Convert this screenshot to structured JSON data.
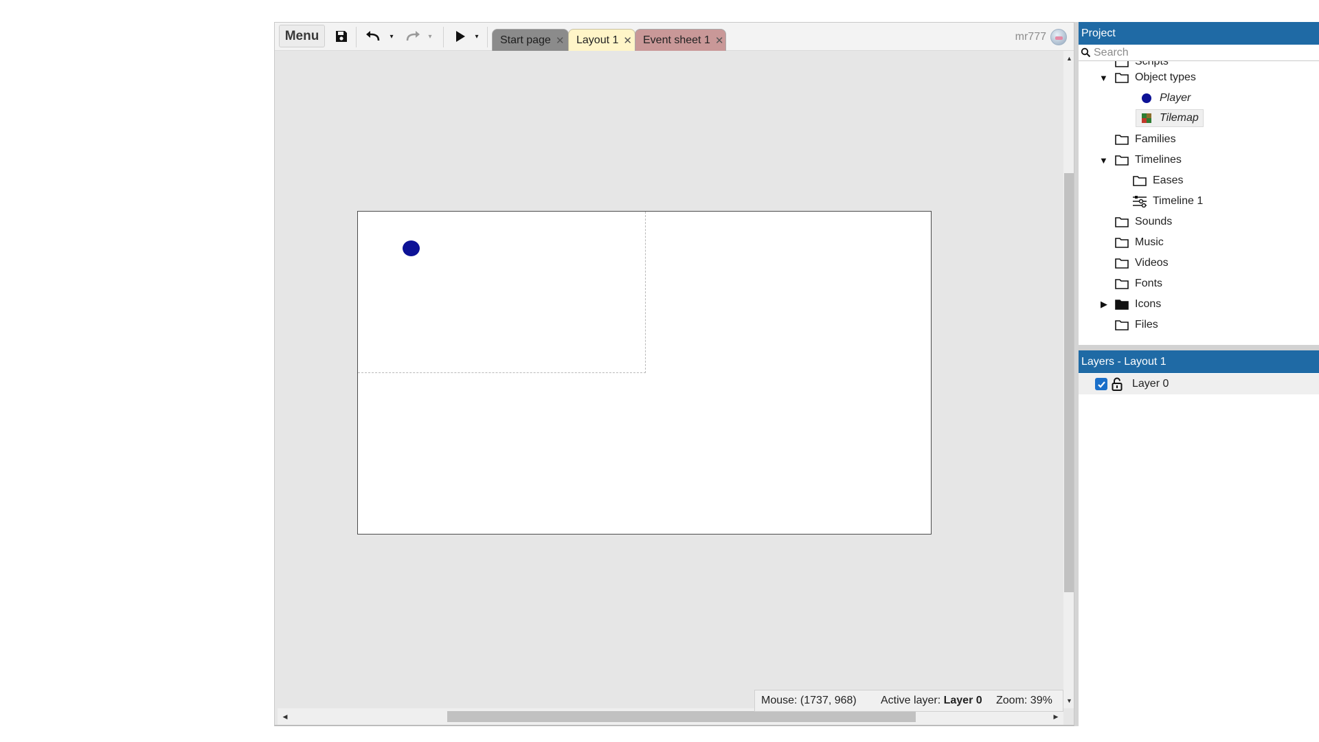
{
  "toolbar": {
    "menu_label": "Menu",
    "save_icon": "save-icon",
    "undo_icon": "undo-icon",
    "redo_icon": "redo-icon",
    "play_icon": "play-icon",
    "dropdown_glyph": "▾"
  },
  "tabs": [
    {
      "label": "Start page",
      "close": "✕",
      "color": "#8b8b8b"
    },
    {
      "label": "Layout 1",
      "close": "✕",
      "color": "#fff5c8",
      "active": true
    },
    {
      "label": "Event sheet 1",
      "close": "✕",
      "color": "#c99898"
    }
  ],
  "user": {
    "name": "mr777"
  },
  "canvas": {
    "background": "#e6e6e6",
    "layout_color": "#ffffff",
    "player_color": "#0d1296"
  },
  "status": {
    "mouse": "Mouse: (1737, 968)",
    "active_layer_label": "Active layer:",
    "active_layer_value": "Layer 0",
    "zoom": "Zoom: 39%"
  },
  "project": {
    "title": "Project",
    "search_placeholder": "Search",
    "items": [
      {
        "label": "Scripts",
        "icon": "folder-icon"
      },
      {
        "label": "Object types",
        "icon": "folder-icon",
        "expanded": true
      },
      {
        "label": "Player",
        "icon": "sprite-dot-icon",
        "italic": true
      },
      {
        "label": "Tilemap",
        "icon": "tilemap-icon",
        "italic": true,
        "selected": true
      },
      {
        "label": "Families",
        "icon": "folder-icon"
      },
      {
        "label": "Timelines",
        "icon": "folder-icon",
        "expanded": true
      },
      {
        "label": "Eases",
        "icon": "folder-icon"
      },
      {
        "label": "Timeline 1",
        "icon": "timeline-icon"
      },
      {
        "label": "Sounds",
        "icon": "folder-icon"
      },
      {
        "label": "Music",
        "icon": "folder-icon"
      },
      {
        "label": "Videos",
        "icon": "folder-icon"
      },
      {
        "label": "Fonts",
        "icon": "folder-icon"
      },
      {
        "label": "Icons",
        "icon": "folder-filled-icon",
        "expanded": false
      },
      {
        "label": "Files",
        "icon": "folder-icon"
      }
    ],
    "tilemap_colors": [
      "#2e7d32",
      "#c0392b"
    ],
    "header_color": "#1f6aa5"
  },
  "layers": {
    "title": "Layers - Layout 1",
    "rows": [
      {
        "label": "Layer 0",
        "visible": true,
        "locked": false
      }
    ]
  }
}
